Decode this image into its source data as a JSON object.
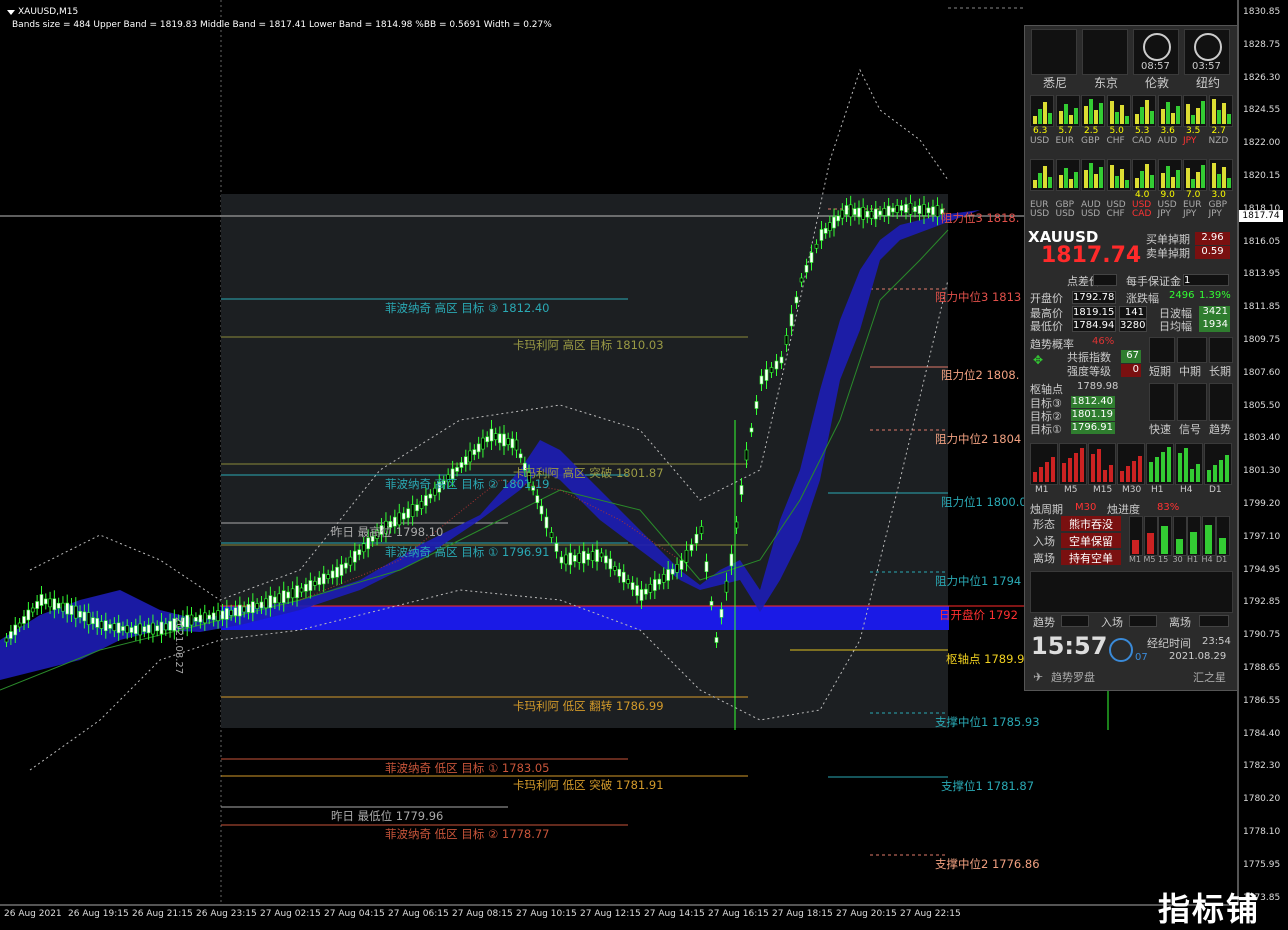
{
  "header": {
    "symbol": "XAUUSD,M15",
    "bands_info": "Bands size = 484 Upper Band = 1819.83 Middle Band = 1817.41 Lower Band = 1814.98 %BB = 0.5691 Width = 0.27%"
  },
  "current_price_tag": "1817.74",
  "price_axis": [
    "1830.85",
    "1828.75",
    "1826.30",
    "1824.55",
    "1822.00",
    "1820.15",
    "1818.10",
    "1816.05",
    "1813.95",
    "1811.85",
    "1809.75",
    "1807.60",
    "1805.50",
    "1803.40",
    "1801.30",
    "1799.20",
    "1797.10",
    "1794.95",
    "1792.85",
    "1790.75",
    "1788.65",
    "1786.55",
    "1784.40",
    "1782.30",
    "1780.20",
    "1778.10",
    "1775.95",
    "1773.85"
  ],
  "time_axis": [
    "26 Aug 2021",
    "26 Aug 19:15",
    "26 Aug 21:15",
    "26 Aug 23:15",
    "27 Aug 02:15",
    "27 Aug 04:15",
    "27 Aug 06:15",
    "27 Aug 08:15",
    "27 Aug 10:15",
    "27 Aug 12:15",
    "27 Aug 14:15",
    "27 Aug 16:15",
    "27 Aug 18:15",
    "27 Aug 20:15",
    "27 Aug 22:15"
  ],
  "vertical_label": "2021.08.27",
  "levels": {
    "fib_high3": "菲波纳奇 高区 目标 ③  1812.40",
    "cam_high_target": "卡玛利阿 高区 目标  1810.03",
    "cam_high_break": "卡玛利阿 高区 突破  1801.87",
    "fib_high2": "菲波纳奇 高区 目标 ②  1801.19",
    "yest_high": "昨日 最高位  1798.10",
    "fib_high1": "菲波纳奇 高区 目标 ①  1796.91",
    "cam_low_reverse": "卡玛利阿 低区 翻转  1786.99",
    "fib_low1": "菲波纳奇 低区 目标 ①  1783.05",
    "cam_low_break": "卡玛利阿 低区 突破  1781.91",
    "yest_low": "昨日 最低位  1779.96",
    "fib_low2": "菲波纳奇 低区 目标 ②  1778.77",
    "res3": "阻力位3  1818.",
    "res_mid3": "阻力中位3  1813",
    "res2": "阻力位2  1808.",
    "res_mid2": "阻力中位2  1804",
    "res1": "阻力位1  1800.0",
    "res_mid1": "阻力中位1  1794",
    "day_open": "日开盘价  1792",
    "pivot": "枢轴点  1789.9",
    "sup_mid1": "支撑中位1  1785.93",
    "sup1": "支撑位1  1781.87",
    "sup_mid2": "支撑中位2  1776.86"
  },
  "panel": {
    "clock_times": [
      "08:57",
      "03:57"
    ],
    "sessions": [
      "悉尼",
      "东京",
      "伦敦",
      "纽约"
    ],
    "strength_values": [
      "6.3",
      "5.7",
      "2.5",
      "5.0",
      "5.3",
      "3.6",
      "3.5",
      "2.7"
    ],
    "currencies": [
      "USD",
      "EUR",
      "GBP",
      "CHF",
      "CAD",
      "AUD",
      "JPY",
      "NZD"
    ],
    "pair_values": [
      "",
      "",
      "",
      "",
      "4.0",
      "9.0",
      "7.0",
      "3.0"
    ],
    "pair_top": [
      "EUR",
      "GBP",
      "AUD",
      "USD",
      "USD",
      "USD",
      "EUR",
      "GBP"
    ],
    "pair_bottom": [
      "USD",
      "USD",
      "USD",
      "CHF",
      "CAD",
      "JPY",
      "JPY",
      "JPY"
    ],
    "symbol": "XAUUSD",
    "price": "1817.74",
    "buy_slip_label": "买单掉期",
    "buy_slip": "2.96",
    "sell_slip_label": "卖单掉期",
    "sell_slip": "0.59",
    "spread_label": "点差价",
    "margin_label": "每手保证金",
    "margin_value": "1",
    "open_label": "开盘价",
    "open_value": "1792.78",
    "change_label": "涨跌幅",
    "change_points": "2496",
    "change_pct": "1.39%",
    "high_label": "最高价",
    "high_value": "1819.15",
    "high_pts": "141",
    "day_wave_label": "日波幅",
    "day_wave": "3421",
    "low_label": "最低价",
    "low_value": "1784.94",
    "low_pts": "3280",
    "day_avg_label": "日均幅",
    "day_avg": "1934",
    "trend_prob_label": "趋势概率",
    "trend_prob": "46%",
    "cofac_label": "共振指数",
    "cofac": "67",
    "strength_label": "强度等级",
    "strength": "0",
    "short_label": "短期",
    "mid_label": "中期",
    "long_label": "长期",
    "pivot_label": "枢轴点",
    "pivot_value": "1789.98",
    "target3_label": "目标③",
    "target3": "1812.40",
    "target2_label": "目标②",
    "target2": "1801.19",
    "target1_label": "目标①",
    "target1": "1796.91",
    "fast_label": "快速",
    "signal_label": "信号",
    "trend_label": "趋势",
    "tf_labels": [
      "M1",
      "M5",
      "M15",
      "M30",
      "H1",
      "H4",
      "D1"
    ],
    "cycle_label": "烛周期",
    "cycle_tf": "M30",
    "progress_label": "烛进度",
    "progress": "83%",
    "shape_label": "形态",
    "shape_value": "熊市吞没",
    "entry_label": "入场",
    "entry_value": "空单保留",
    "exit_label": "离场",
    "exit_value": "持有空单",
    "mini_tf": [
      "M1",
      "M5",
      "15",
      "30",
      "H1",
      "H4",
      "D1"
    ],
    "trend_bottom_label": "趋势",
    "entry_bottom_label": "入场",
    "exit_bottom_label": "离场",
    "time_big": "15:57",
    "day_num": "07",
    "elapsed_label": "经纪时间",
    "elapsed_value": "23:54",
    "date": "2021.08.29",
    "brand_left": "趋势罗盘",
    "brand_right": "汇之星"
  },
  "watermark": "指标铺"
}
